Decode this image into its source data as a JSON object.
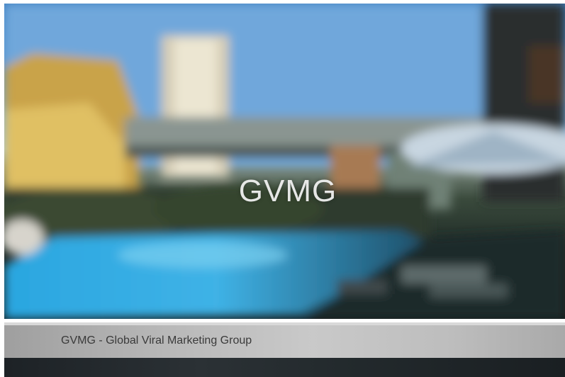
{
  "hero": {
    "title": "GVMG",
    "image_icon": "blurred-hotel-rooftop-pool-photo"
  },
  "caption": {
    "text": "GVMG - Global Viral Marketing Group"
  },
  "colors": {
    "caption_text": "#3a3a3a",
    "hero_title": "#f5f5f5",
    "pool": "#2f9fd8"
  }
}
